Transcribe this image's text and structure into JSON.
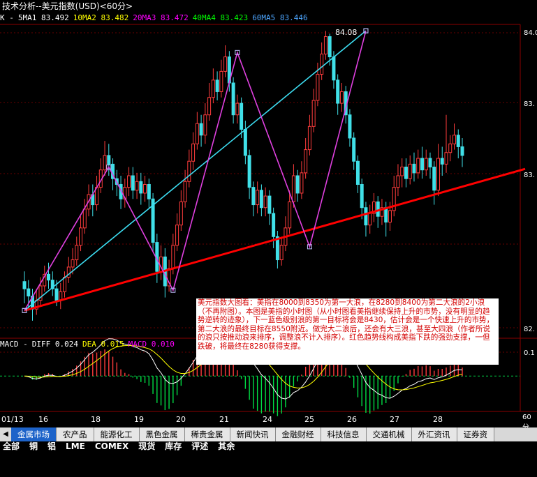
{
  "window": {
    "title": "技术分析--美元指数(USD)<60分>"
  },
  "legend_top": [
    {
      "label": "K -",
      "color": "#ffffff"
    },
    {
      "label": "5MA1",
      "value": "83.492",
      "color": "#ffffff"
    },
    {
      "label": "10MA2",
      "value": "83.482",
      "color": "#ffff00"
    },
    {
      "label": "20MA3",
      "value": "83.472",
      "color": "#ff00ff"
    },
    {
      "label": "40MA4",
      "value": "83.423",
      "color": "#00ff00"
    },
    {
      "label": "60MA5",
      "value": "83.446",
      "color": "#4da6ff"
    }
  ],
  "legend_macd": [
    {
      "label": "MACD -",
      "color": "#ffffff"
    },
    {
      "label": "DIFF",
      "value": "0.024",
      "color": "#ffffff"
    },
    {
      "label": "DEA",
      "value": "0.015",
      "color": "#ffff00"
    },
    {
      "label": "MACD",
      "value": "0.010",
      "color": "#ff00ff"
    }
  ],
  "annotation": "美元指数大图看：美指在8000到8350为第一大浪，在8280到8400为第二大浪的2小浪（不再附图）。本图是美指的小时图（从小时图看美指继续保持上升的市势，没有明显的趋势逆转的迹象），下一蓝色级别浪的第一目标将会是8430，估计会是一个快速上升的市势，第二大浪的最终目标在8550附近。做完大二浪后，还会有大三浪，甚至大四浪（作者所说的浪只按推动浪来排序，调整浪不计入排序）。红色趋势线构成美指下跌的强劲支撑，一但跌破，将最终在8280获得支撑。",
  "peak_label": "84.08",
  "right_axis_labels": [
    "84.0",
    "83.",
    "83.",
    "82.",
    "0.1"
  ],
  "macd_unit": "60分",
  "colors": {
    "up": "#ff3c3c",
    "down": "#40e0e8",
    "trend": "#ff0000",
    "blue_wave": "#3cdcf0",
    "magenta_wave": "#e040e0"
  },
  "tabs": {
    "items": [
      "金属市场",
      "农产品",
      "能源化工",
      "黑色金属",
      "稀贵金属",
      "新闻快讯",
      "金融财经",
      "科技信息",
      "交通机械",
      "外汇资讯",
      "证券资"
    ],
    "active": 0
  },
  "status_row": [
    "全部",
    "铜",
    "铝",
    "LME",
    "COMEX",
    "现货",
    "库存",
    "评述",
    "其余"
  ],
  "chart_data": {
    "type": "candlestick",
    "symbol": "美元指数(USD)",
    "period": "60分",
    "x_labels": [
      "01/13",
      "16",
      "18",
      "19",
      "20",
      "21",
      "24",
      "25",
      "26",
      "27",
      "28"
    ],
    "price_ylim": [
      82.06,
      84.1
    ],
    "peak": 84.08,
    "candles": [
      [
        82.35,
        82.3,
        82.42,
        82.2
      ],
      [
        82.3,
        82.25,
        82.36,
        82.15
      ],
      [
        82.25,
        82.16,
        82.3,
        82.08
      ],
      [
        82.16,
        82.22,
        82.3,
        82.12
      ],
      [
        82.22,
        82.32,
        82.38,
        82.18
      ],
      [
        82.32,
        82.4,
        82.46,
        82.28
      ],
      [
        82.4,
        82.36,
        82.48,
        82.3
      ],
      [
        82.36,
        82.3,
        82.42,
        82.25
      ],
      [
        82.3,
        82.22,
        82.36,
        82.18
      ],
      [
        82.22,
        82.28,
        82.34,
        82.16
      ],
      [
        82.28,
        82.38,
        82.42,
        82.24
      ],
      [
        82.38,
        82.45,
        82.52,
        82.34
      ],
      [
        82.45,
        82.5,
        82.58,
        82.4
      ],
      [
        82.5,
        82.6,
        82.66,
        82.46
      ],
      [
        82.6,
        82.72,
        82.8,
        82.56
      ],
      [
        82.72,
        82.85,
        82.92,
        82.68
      ],
      [
        82.85,
        82.95,
        83.02,
        82.8
      ],
      [
        82.95,
        82.88,
        83.02,
        82.8
      ],
      [
        82.88,
        83.0,
        83.08,
        82.84
      ],
      [
        83.0,
        83.12,
        83.2,
        82.96
      ],
      [
        83.12,
        83.22,
        83.32,
        83.08
      ],
      [
        83.22,
        83.16,
        83.3,
        83.08
      ],
      [
        83.16,
        83.06,
        83.2,
        82.98
      ],
      [
        83.06,
        83.02,
        83.12,
        82.94
      ],
      [
        83.02,
        82.92,
        83.08,
        82.85
      ],
      [
        82.92,
        83.0,
        83.06,
        82.86
      ],
      [
        83.0,
        83.08,
        83.14,
        82.94
      ],
      [
        83.08,
        82.98,
        83.14,
        82.92
      ],
      [
        82.98,
        83.04,
        83.1,
        82.92
      ],
      [
        83.04,
        82.96,
        83.1,
        82.88
      ],
      [
        82.96,
        83.02,
        83.08,
        82.9
      ],
      [
        83.02,
        82.92,
        83.06,
        82.86
      ],
      [
        82.92,
        82.62,
        82.96,
        82.56
      ],
      [
        82.62,
        82.42,
        82.68,
        82.34
      ],
      [
        82.42,
        82.52,
        82.6,
        82.36
      ],
      [
        82.52,
        82.32,
        82.58,
        82.24
      ],
      [
        82.32,
        82.44,
        82.5,
        82.28
      ],
      [
        82.44,
        82.6,
        82.68,
        82.4
      ],
      [
        82.6,
        82.74,
        82.82,
        82.56
      ],
      [
        82.74,
        82.9,
        82.98,
        82.7
      ],
      [
        82.9,
        83.04,
        83.12,
        82.86
      ],
      [
        83.04,
        83.18,
        83.26,
        83.0
      ],
      [
        83.18,
        83.3,
        83.38,
        83.12
      ],
      [
        83.3,
        83.44,
        83.52,
        83.26
      ],
      [
        83.44,
        83.36,
        83.5,
        83.28
      ],
      [
        83.36,
        83.5,
        83.58,
        83.3
      ],
      [
        83.5,
        83.62,
        83.72,
        83.46
      ],
      [
        83.62,
        83.74,
        83.82,
        83.58
      ],
      [
        83.74,
        83.66,
        83.8,
        83.6
      ],
      [
        83.66,
        83.8,
        83.88,
        83.62
      ],
      [
        83.8,
        83.9,
        83.98,
        83.76
      ],
      [
        83.9,
        83.72,
        83.94,
        83.66
      ],
      [
        83.72,
        83.5,
        83.76,
        83.44
      ],
      [
        83.5,
        83.58,
        83.64,
        83.44
      ],
      [
        83.58,
        83.4,
        83.62,
        83.34
      ],
      [
        83.4,
        83.22,
        83.46,
        83.16
      ],
      [
        83.22,
        83.0,
        83.26,
        82.92
      ],
      [
        83.0,
        82.88,
        83.04,
        82.8
      ],
      [
        82.88,
        82.98,
        83.04,
        82.82
      ],
      [
        82.98,
        82.86,
        83.02,
        82.8
      ],
      [
        82.86,
        82.94,
        83.0,
        82.8
      ],
      [
        82.94,
        82.82,
        82.98,
        82.74
      ],
      [
        82.82,
        82.66,
        82.86,
        82.58
      ],
      [
        82.66,
        82.5,
        82.7,
        82.44
      ],
      [
        82.5,
        82.6,
        82.66,
        82.46
      ],
      [
        82.6,
        82.72,
        82.8,
        82.56
      ],
      [
        82.72,
        82.9,
        82.98,
        82.68
      ],
      [
        82.9,
        83.08,
        83.16,
        82.86
      ],
      [
        83.08,
        82.96,
        83.12,
        82.9
      ],
      [
        82.96,
        83.1,
        83.18,
        82.92
      ],
      [
        83.1,
        83.26,
        83.34,
        83.06
      ],
      [
        83.26,
        83.42,
        83.5,
        83.22
      ],
      [
        83.42,
        83.6,
        83.68,
        83.38
      ],
      [
        83.6,
        83.78,
        83.86,
        83.56
      ],
      [
        83.78,
        83.92,
        84.0,
        83.74
      ],
      [
        83.92,
        84.04,
        84.08,
        83.88
      ],
      [
        84.04,
        83.9,
        84.06,
        83.84
      ],
      [
        83.9,
        83.74,
        83.94,
        83.68
      ],
      [
        83.74,
        83.58,
        83.78,
        83.5
      ],
      [
        83.58,
        83.66,
        83.72,
        83.52
      ],
      [
        83.66,
        83.5,
        83.7,
        83.44
      ],
      [
        83.5,
        83.34,
        83.54,
        83.28
      ],
      [
        83.34,
        83.18,
        83.38,
        83.12
      ],
      [
        83.18,
        83.02,
        83.22,
        82.96
      ],
      [
        83.02,
        82.86,
        83.06,
        82.78
      ],
      [
        82.86,
        82.74,
        82.9,
        82.66
      ],
      [
        82.74,
        82.82,
        82.88,
        82.68
      ],
      [
        82.82,
        82.9,
        82.96,
        82.76
      ],
      [
        82.9,
        82.8,
        82.94,
        82.72
      ],
      [
        82.8,
        82.86,
        82.92,
        82.74
      ],
      [
        82.86,
        82.76,
        82.9,
        82.66
      ],
      [
        82.76,
        82.84,
        82.9,
        82.7
      ],
      [
        82.84,
        83.0,
        83.08,
        82.8
      ],
      [
        83.0,
        83.08,
        83.16,
        82.94
      ],
      [
        83.08,
        83.14,
        83.2,
        83.0
      ],
      [
        83.14,
        83.06,
        83.2,
        83.0
      ],
      [
        83.06,
        83.16,
        83.22,
        83.02
      ],
      [
        83.16,
        83.1,
        83.24,
        83.04
      ],
      [
        83.1,
        83.2,
        83.26,
        83.06
      ],
      [
        83.2,
        83.12,
        83.28,
        83.06
      ],
      [
        83.12,
        83.2,
        83.26,
        83.08
      ],
      [
        83.2,
        83.14,
        83.24,
        83.06
      ],
      [
        83.14,
        82.98,
        83.18,
        82.88
      ],
      [
        82.98,
        83.2,
        83.3,
        82.94
      ],
      [
        83.2,
        83.16,
        83.28,
        83.08
      ],
      [
        83.16,
        83.24,
        83.5,
        83.1
      ],
      [
        83.24,
        83.3,
        83.36,
        83.18
      ],
      [
        83.3,
        83.36,
        83.44,
        83.26
      ],
      [
        83.36,
        83.28,
        83.4,
        83.2
      ],
      [
        83.28,
        83.22,
        83.34,
        83.14
      ]
    ],
    "macd_ylim": [
      -0.18,
      0.12
    ],
    "trendlines": [
      {
        "name": "support",
        "color": "red",
        "points": [
          [
            0,
            82.15
          ],
          [
            125,
            83.13
          ]
        ]
      },
      {
        "name": "blue wave",
        "color": "cyan",
        "points": [
          [
            0,
            82.15
          ],
          [
            85,
            84.08
          ]
        ]
      },
      {
        "name": "wave 1",
        "color": "magenta",
        "points": [
          [
            0,
            82.15
          ],
          [
            21,
            83.14
          ],
          [
            37,
            82.29
          ],
          [
            53,
            83.93
          ],
          [
            71,
            82.59
          ],
          [
            85,
            84.08
          ]
        ]
      }
    ]
  }
}
